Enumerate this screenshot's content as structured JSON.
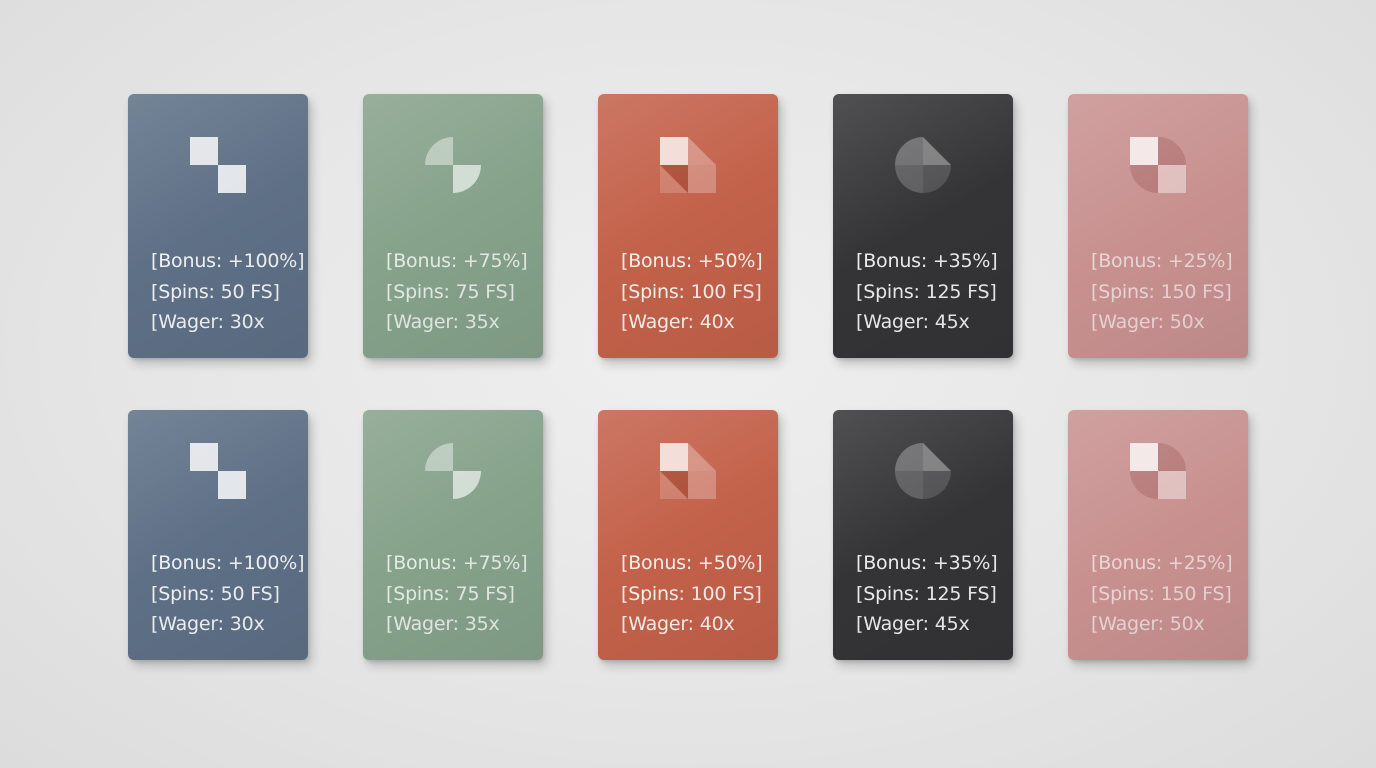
{
  "cards": [
    {
      "bonus": "[Bonus: +100%]",
      "spins": "[Spins: 50 FS]",
      "wager": "[Wager: 30x",
      "color": "#5d6f84",
      "icon": "checker-squares-icon"
    },
    {
      "bonus": "[Bonus: +75%]",
      "spins": "[Spins: 75 FS]",
      "wager": "[Wager: 35x",
      "color": "#85a18a",
      "icon": "quarter-circles-icon"
    },
    {
      "bonus": "[Bonus: +50%]",
      "spins": "[Spins: 100 FS]",
      "wager": "[Wager: 40x",
      "color": "#c2614a",
      "icon": "triangle-squares-icon"
    },
    {
      "bonus": "[Bonus: +35%]",
      "spins": "[Spins: 125 FS]",
      "wager": "[Wager: 45x",
      "color": "#343436",
      "icon": "segmented-circle-icon"
    },
    {
      "bonus": "[Bonus: +25%]",
      "spins": "[Spins: 150 FS]",
      "wager": "[Wager: 50x",
      "color": "#c68f8e",
      "icon": "square-and-circle-icon"
    },
    {
      "bonus": "[Bonus: +100%]",
      "spins": "[Spins: 50 FS]",
      "wager": "[Wager: 30x",
      "color": "#5d6f84",
      "icon": "checker-squares-icon"
    },
    {
      "bonus": "[Bonus: +75%]",
      "spins": "[Spins: 75 FS]",
      "wager": "[Wager: 35x",
      "color": "#85a18a",
      "icon": "quarter-circles-icon"
    },
    {
      "bonus": "[Bonus: +50%]",
      "spins": "[Spins: 100 FS]",
      "wager": "[Wager: 40x",
      "color": "#c2614a",
      "icon": "triangle-squares-icon"
    },
    {
      "bonus": "[Bonus: +35%]",
      "spins": "[Spins: 125 FS]",
      "wager": "[Wager: 45x",
      "color": "#343436",
      "icon": "segmented-circle-icon"
    },
    {
      "bonus": "[Bonus: +25%]",
      "spins": "[Spins: 150 FS]",
      "wager": "[Wager: 50x",
      "color": "#c68f8e",
      "icon": "square-and-circle-icon"
    }
  ]
}
